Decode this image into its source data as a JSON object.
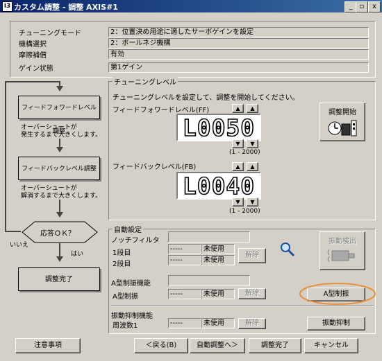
{
  "window": {
    "title": "カスタム調整 - 調整 AXIS#1",
    "app_icon": "i3",
    "min": "_",
    "restore": "▫",
    "close": "x"
  },
  "info": {
    "rows": [
      {
        "label": "チューニングモード",
        "value": "2：位置決め用途に適したサーボゲインを設定"
      },
      {
        "label": "機構選択",
        "value": "2：ボールネジ機構"
      },
      {
        "label": "摩擦補償",
        "value": "有効"
      },
      {
        "label": "ゲイン状態",
        "value": "第1ゲイン"
      }
    ]
  },
  "flow": {
    "ff_box": "フィードフォワードレベル調整",
    "ff_note1": "オーバーシュートが",
    "ff_note2": "発生するまで大きくします。",
    "fb_box": "フィードバックレベル調整",
    "fb_note1": "オーバーシュートが",
    "fb_note2": "解消するまで大きくします。",
    "decision": "応答ＯＫ？",
    "no": "いいえ",
    "yes": "はい",
    "done": "調整完了"
  },
  "tuning": {
    "group": "チューニングレベル",
    "instruction": "チューニングレベルを設定して、調整を開始してください。",
    "ff_label": "フィードフォワードレベル(FF)",
    "ff_value": "L0050",
    "ff_range": "(1 - 2000)",
    "fb_label": "フィードバックレベル(FB)",
    "fb_value": "L0040",
    "fb_range": "(1 - 2000)",
    "up": "▲",
    "down": "▼",
    "start_button": "調整開始"
  },
  "auto": {
    "group": "自動設定",
    "notch_label": "ノッチフィルタ",
    "stage1": "1段目",
    "stage2": "2段目",
    "dash": "-----",
    "unused": "未使用",
    "release": "解除",
    "vib_detect": "振動検出",
    "a_func": "A型制振機能",
    "a_label": "A型制振",
    "a_button": "A型制振",
    "vib_sup_func": "振動抑制機能",
    "freq1": "周波数1",
    "vib_sup_button": "振動抑制"
  },
  "footer": {
    "caution": "注意事項",
    "back": "＜戻る(B)",
    "auto_adjust": "自動調整へ＞",
    "finish": "調整完了",
    "cancel": "キャンセル"
  },
  "colors": {
    "highlight_ellipse": "#e8903a",
    "titlebar": "#0a246a"
  }
}
